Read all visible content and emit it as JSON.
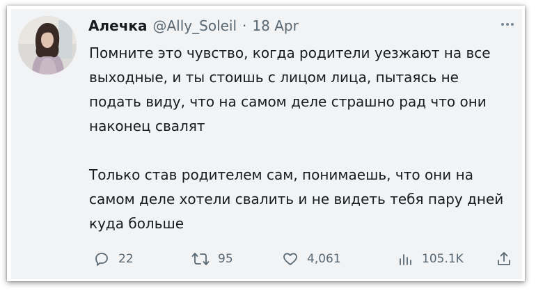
{
  "tweet": {
    "display_name": "Алечка",
    "handle": "@Ally_Soleil",
    "separator": "·",
    "date": "18 Apr",
    "paragraphs": [
      "Помните это чувство, когда родители уезжают на все выходные, и ты стоишь с лицом лица, пытаясь не подать виду, что на самом деле страшно рад что они наконец свалят",
      "Только став родителем сам, понимаешь, что они на самом деле хотели свалить и не видеть тебя пару дней куда больше"
    ],
    "actions": {
      "replies": "22",
      "retweets": "95",
      "likes": "4,061",
      "views": "105.1K"
    },
    "icons": [
      "more-icon",
      "reply-icon",
      "retweet-icon",
      "like-icon",
      "views-icon",
      "share-icon"
    ]
  },
  "colors": {
    "background": "#f1f3f5",
    "text": "#161b20",
    "muted": "#596873"
  }
}
